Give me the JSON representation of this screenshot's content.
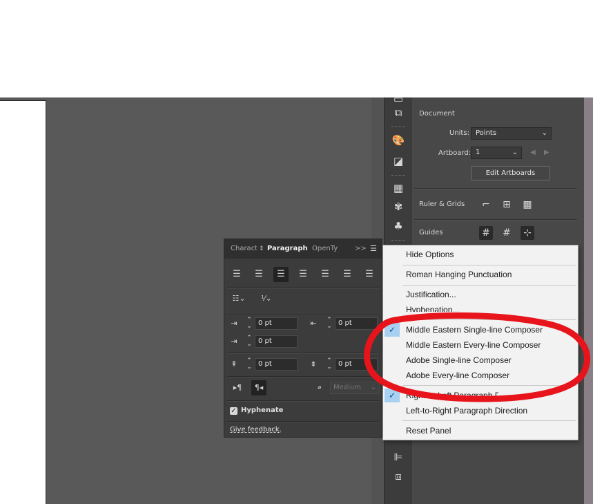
{
  "properties": {
    "section_document": "Document",
    "units_label": "Units:",
    "units_value": "Points",
    "artboard_label": "Artboard:",
    "artboard_value": "1",
    "edit_artboards": "Edit Artboards",
    "section_ruler": "Ruler & Grids",
    "section_guides": "Guides"
  },
  "paragraph_panel": {
    "tabs": [
      "Characte",
      "Paragraph",
      "OpenTyp"
    ],
    "overflow": ">>",
    "indent_left": "0 pt",
    "indent_right": "0 pt",
    "indent_first": "0 pt",
    "space_before": "0 pt",
    "space_after": "0 pt",
    "kashida": "Medium",
    "hyphenate_label": "Hyphenate",
    "feedback_link": "Give feedback."
  },
  "menu": {
    "hide_options": "Hide Options",
    "roman_hanging": "Roman Hanging Punctuation",
    "justification": "Justification...",
    "hyphenation": "Hyphenation...",
    "composers": [
      "Middle Eastern Single-line Composer",
      "Middle Eastern Every-line Composer",
      "Adobe Single-line Composer",
      "Adobe Every-line Composer"
    ],
    "rtl_direction": "Right-to-Left Paragraph Direction",
    "ltr_direction": "Left-to-Right Paragraph Direction",
    "reset_panel": "Reset Panel"
  },
  "colors": {
    "annotation": "#e8141c",
    "checked_bg": "#a8d0f0"
  }
}
